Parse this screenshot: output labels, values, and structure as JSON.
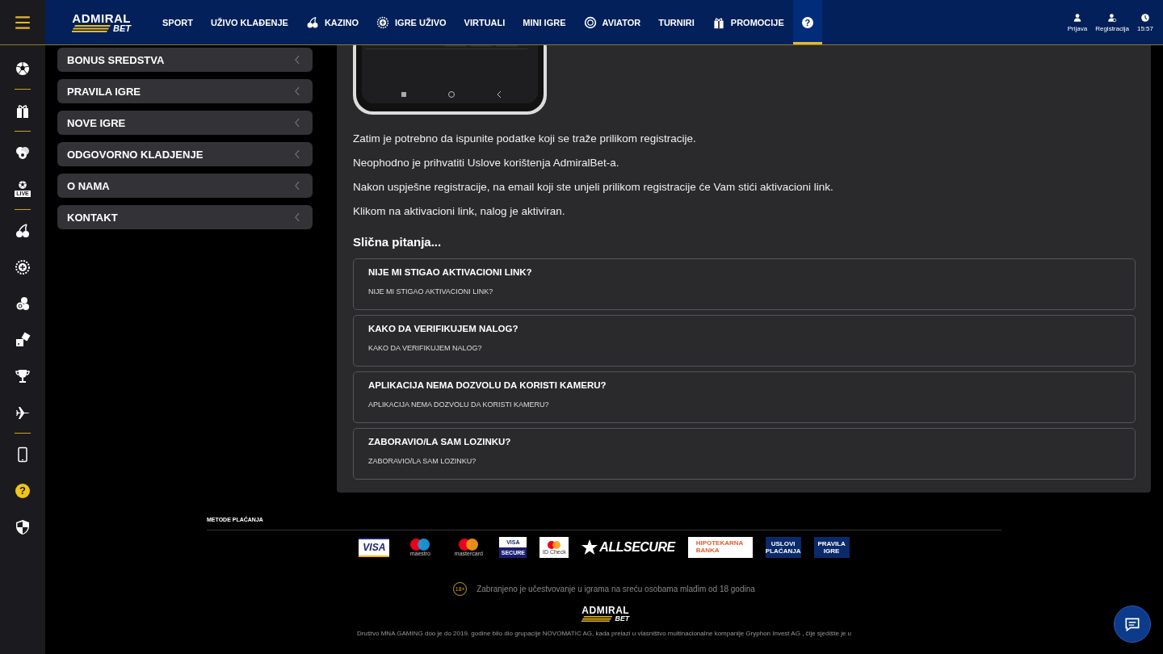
{
  "header": {
    "logo": {
      "top": "ADMIRAL",
      "bottom": "BET"
    },
    "nav": [
      {
        "label": "SPORT",
        "kind": "plain",
        "selected": false
      },
      {
        "label": "UŽIVO KLAĐENJE",
        "kind": "plain",
        "selected": false
      },
      {
        "label": "KAZINO",
        "kind": "cherries",
        "selected": false
      },
      {
        "label": "IGRE UŽIVO",
        "kind": "roulette",
        "selected": false
      },
      {
        "label": "VIRTUALI",
        "kind": "plain",
        "selected": false
      },
      {
        "label": "MINI IGRE",
        "kind": "plain",
        "selected": false
      },
      {
        "label": "AVIATOR",
        "kind": "chip",
        "selected": false
      },
      {
        "label": "TURNIRI",
        "kind": "plain",
        "selected": false
      },
      {
        "label": "PROMOCIJE",
        "kind": "gift",
        "selected": false
      },
      {
        "label": "?",
        "kind": "help",
        "selected": true
      }
    ],
    "account": [
      {
        "label": "Prijava",
        "kind": "user"
      },
      {
        "label": "Registracija",
        "kind": "user-add"
      },
      {
        "label": "15:57",
        "kind": "clock"
      }
    ]
  },
  "sidebar": [
    {
      "kind": "menu"
    },
    {
      "kind": "ball"
    },
    {
      "kind": "divider"
    },
    {
      "kind": "gift"
    },
    {
      "kind": "divider"
    },
    {
      "kind": "chips"
    },
    {
      "kind": "live",
      "label": "LIVE"
    },
    {
      "kind": "divider"
    },
    {
      "kind": "cherries"
    },
    {
      "kind": "roulette"
    },
    {
      "kind": "coins"
    },
    {
      "kind": "dice"
    },
    {
      "kind": "trophy"
    },
    {
      "kind": "plane"
    },
    {
      "kind": "divider"
    },
    {
      "kind": "phone"
    },
    {
      "kind": "help",
      "label": "?"
    },
    {
      "kind": "shield"
    }
  ],
  "info_menu": [
    "BONUS SREDSTVA",
    "PRAVILA IGRE",
    "NOVE IGRE",
    "ODGOVORNO KLADJENJE",
    "O NAMA",
    "KONTAKT"
  ],
  "article": {
    "paragraphs": [
      "Zatim je potrebno da ispunite podatke koji se traže prilikom registracije.",
      "Neophodno je prihvatiti Uslove korištenja AdmiralBet-a.",
      "Nakon uspješne registracije, na email koji ste unjeli prilikom registracije će Vam stići aktivacioni link.",
      "Klikom na aktivacioni link, nalog je aktiviran."
    ],
    "related_title": "Slična pitanja...",
    "related": [
      {
        "title": "NIJE MI STIGAO AKTIVACIONI LINK?",
        "subtitle": "NIJE MI STIGAO AKTIVACIONI LINK?"
      },
      {
        "title": "KAKO DA VERIFIKUJEM NALOG?",
        "subtitle": "KAKO DA VERIFIKUJEM NALOG?"
      },
      {
        "title": "APLIKACIJA NEMA DOZVOLU DA KORISTI KAMERU?",
        "subtitle": "APLIKACIJA NEMA DOZVOLU DA KORISTI KAMERU?"
      },
      {
        "title": "ZABORAVIO/LA SAM LOZINKU?",
        "subtitle": "ZABORAVIO/LA SAM LOZINKU?"
      }
    ]
  },
  "footer": {
    "payment_title": "METODE PLAĆANJA",
    "payments": [
      {
        "kind": "visa",
        "text": "VISA"
      },
      {
        "kind": "maestro",
        "text": "maestro"
      },
      {
        "kind": "mastercard",
        "text": "mastercard"
      },
      {
        "kind": "visa-secure",
        "text": "VISA",
        "sub": "SECURE"
      },
      {
        "kind": "idcheck",
        "text": "ID Check"
      },
      {
        "kind": "allsecure",
        "text": "ALLSECURE"
      },
      {
        "kind": "bank",
        "text": "HIPOTEKARNA",
        "sub": "BANKA"
      },
      {
        "kind": "link",
        "text": "USLOVI",
        "sub": "PLAĆANJA"
      },
      {
        "kind": "link",
        "text": "PRAVILA",
        "sub": "IGRE"
      }
    ],
    "age_badge": "18+",
    "age_notice": "Zabranjeno je učestvovanje u igrama na sreću osobama mlađim od 18 godina",
    "logo": {
      "top": "ADMIRAL",
      "bottom": "BET"
    },
    "legal": "Društvo MNA GAMING doo je do 2019. godine bilo dio grupacije NOVOMATIC AG, kada prelazi u vlasništvo multinacionalne kompanije Gryphon Invest AG , čije sjedište je u"
  }
}
